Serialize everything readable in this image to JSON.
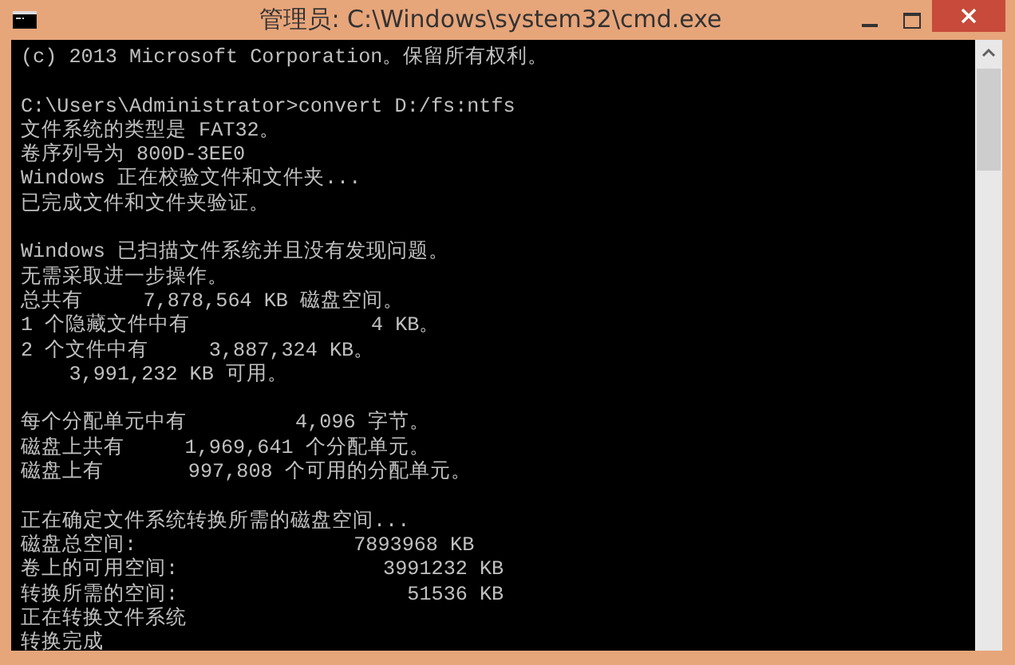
{
  "window": {
    "title": "管理员: C:\\Windows\\system32\\cmd.exe"
  },
  "console": {
    "blocks": [
      [
        "(c) 2013 Microsoft Corporation。保留所有权利。"
      ],
      [
        "C:\\Users\\Administrator>convert D:/fs:ntfs",
        "文件系统的类型是 FAT32。",
        "卷序列号为 800D-3EE0",
        "Windows 正在校验文件和文件夹...",
        "已完成文件和文件夹验证。"
      ],
      [
        "Windows 已扫描文件系统并且没有发现问题。",
        "无需采取进一步操作。",
        "总共有     7,878,564 KB 磁盘空间。",
        "1 个隐藏文件中有               4 KB。",
        "2 个文件中有     3,887,324 KB。",
        "    3,991,232 KB 可用。"
      ],
      [
        "每个分配单元中有         4,096 字节。",
        "磁盘上共有     1,969,641 个分配单元。",
        "磁盘上有       997,808 个可用的分配单元。"
      ],
      [
        "正在确定文件系统转换所需的磁盘空间...",
        "磁盘总空间:                  7893968 KB",
        "卷上的可用空间:                 3991232 KB",
        "转换所需的空间:                   51536 KB",
        "正在转换文件系统",
        "转换完成"
      ]
    ]
  }
}
